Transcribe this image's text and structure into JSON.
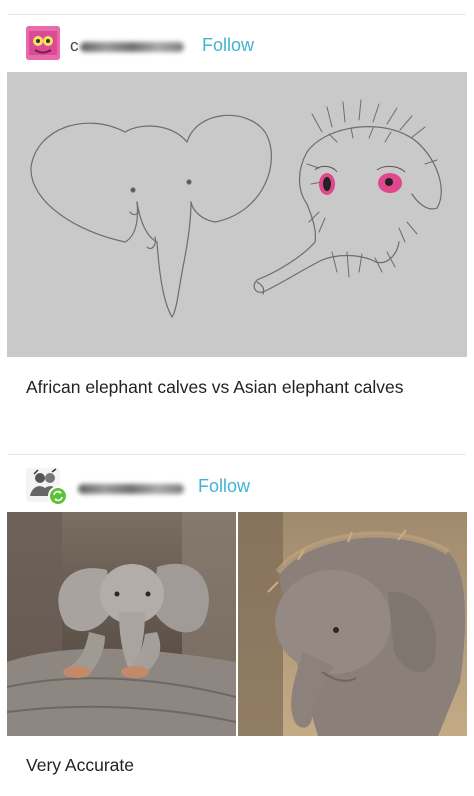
{
  "post1": {
    "username_initial": "c",
    "follow_label": "Follow",
    "caption": "African elephant calves vs Asian elephant calves"
  },
  "post2": {
    "follow_label": "Follow",
    "caption": "Very Accurate"
  },
  "icons": {
    "avatar1": "pink-mask-avatar",
    "avatar2": "group-avatar-with-green-badge"
  },
  "colors": {
    "follow": "#43b3d5",
    "sketch_bg": "#c9c9c9",
    "eye_pink": "#e0478c"
  }
}
